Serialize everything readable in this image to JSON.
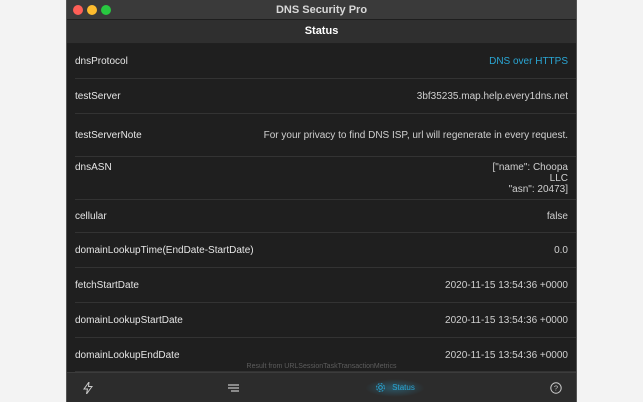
{
  "app": {
    "title": "DNS Security Pro"
  },
  "nav": {
    "title": "Status"
  },
  "rows": [
    {
      "key": "dnsProtocol",
      "value": "DNS over HTTPS",
      "accent": true
    },
    {
      "key": "testServer",
      "value": "3bf35235.map.help.every1dns.net"
    },
    {
      "key": "testServerNote",
      "value": "For your privacy to find DNS ISP, url will regenerate in every request."
    },
    {
      "key": "dnsASN",
      "value": "[\"name\": Choopa\nLLC\n\"asn\": 20473]"
    },
    {
      "key": "cellular",
      "value": "false"
    },
    {
      "key": "domainLookupTime(EndDate-StartDate)",
      "value": "0.0"
    },
    {
      "key": "fetchStartDate",
      "value": "2020-11-15 13:54:36 +0000"
    },
    {
      "key": "domainLookupStartDate",
      "value": "2020-11-15 13:54:36 +0000"
    },
    {
      "key": "domainLookupEndDate",
      "value": "2020-11-15 13:54:36 +0000"
    }
  ],
  "footer": {
    "note": "Result from URLSessionTaskTransactionMetrics"
  },
  "tabs": [
    {
      "icon": "bolt-icon",
      "label": ""
    },
    {
      "icon": "list-icon",
      "label": ""
    },
    {
      "icon": "gear-icon",
      "label": "Status",
      "active": true
    },
    {
      "icon": "help-icon",
      "label": ""
    }
  ],
  "colors": {
    "accent": "#2aa6d4",
    "background": "#1f1f1f"
  }
}
